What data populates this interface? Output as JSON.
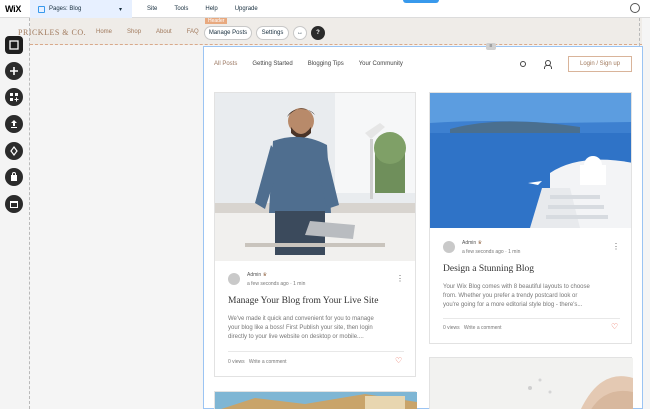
{
  "topbar": {
    "logo": "WiX",
    "pages_label": "Pages: Blog",
    "menu": [
      "Site",
      "Tools",
      "Help",
      "Upgrade"
    ]
  },
  "site_header": {
    "brand": "PRICKLES & CO.",
    "nav": [
      "Home",
      "Shop",
      "About",
      "FAQ"
    ],
    "tag": "Header"
  },
  "toolbar": {
    "manage_posts": "Manage Posts",
    "settings": "Settings",
    "stretch_symbol": "↔",
    "help_symbol": "?"
  },
  "blog_nav": {
    "items": [
      "All Posts",
      "Getting Started",
      "Blogging Tips",
      "Your Community"
    ],
    "login": "Login / Sign up"
  },
  "posts": [
    {
      "author": "Admin",
      "time": "a few seconds ago · 1 min",
      "title": "Manage Your Blog from Your Live Site",
      "desc_lines": [
        "We've made it quick and convenient for you to manage",
        "your blog like a boss! First Publish your site, then login",
        "directly to your live website on desktop or mobile...."
      ],
      "views": "0 views",
      "comment": "Write a comment"
    },
    {
      "author": "Admin",
      "time": "a few seconds ago · 1 min",
      "title": "Design a Stunning Blog",
      "desc_lines": [
        "Your Wix Blog comes with 8 beautiful layouts to choose",
        "from. Whether you prefer a trendy postcard look or",
        "you're going for a more editorial style blog - there's..."
      ],
      "views": "0 views",
      "comment": "Write a comment"
    }
  ],
  "colors": {
    "accent": "#3899ec",
    "brand": "#a0795c",
    "heart": "#e85d4a"
  }
}
